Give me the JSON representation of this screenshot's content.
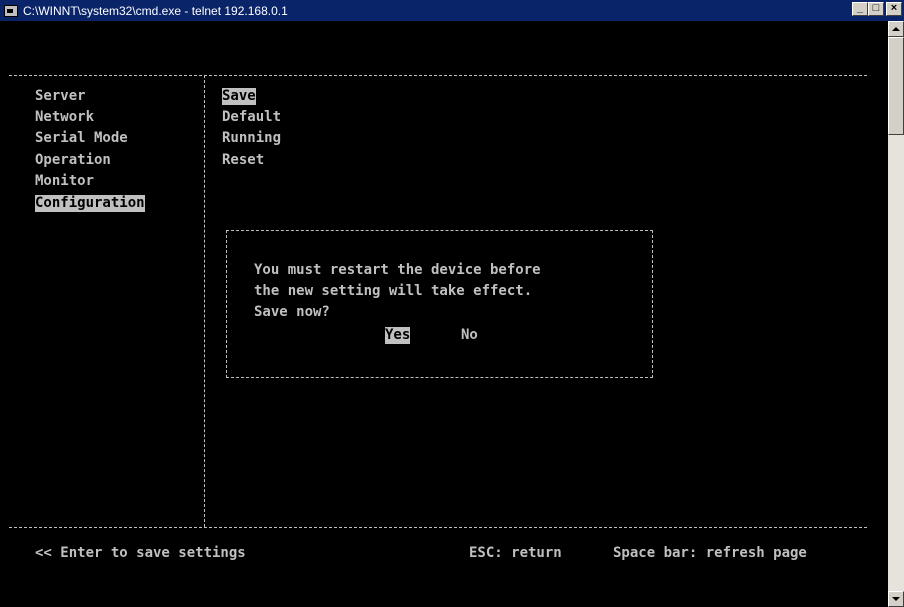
{
  "window": {
    "title": "C:\\WINNT\\system32\\cmd.exe - telnet 192.168.0.1",
    "minimize": "_",
    "maximize": "□",
    "close": "×"
  },
  "menu": {
    "items": [
      "Server",
      "Network",
      "Serial Mode",
      "Operation",
      "Monitor",
      "Configuration"
    ],
    "selected_index": 5
  },
  "submenu": {
    "items": [
      "Save",
      "Default",
      "Running",
      "Reset"
    ],
    "selected_index": 0
  },
  "dialog": {
    "lines": [
      "You must restart the device before",
      "the new setting will take effect.",
      "Save now?"
    ],
    "yes_label": "Yes",
    "no_label": "No"
  },
  "footer": {
    "hint": "<< Enter to save settings",
    "esc": "ESC: return",
    "space": "Space bar: refresh page"
  },
  "colors": {
    "console_bg": "#000000",
    "console_fg": "#c0c0c0",
    "titlebar": "#0a246a"
  }
}
